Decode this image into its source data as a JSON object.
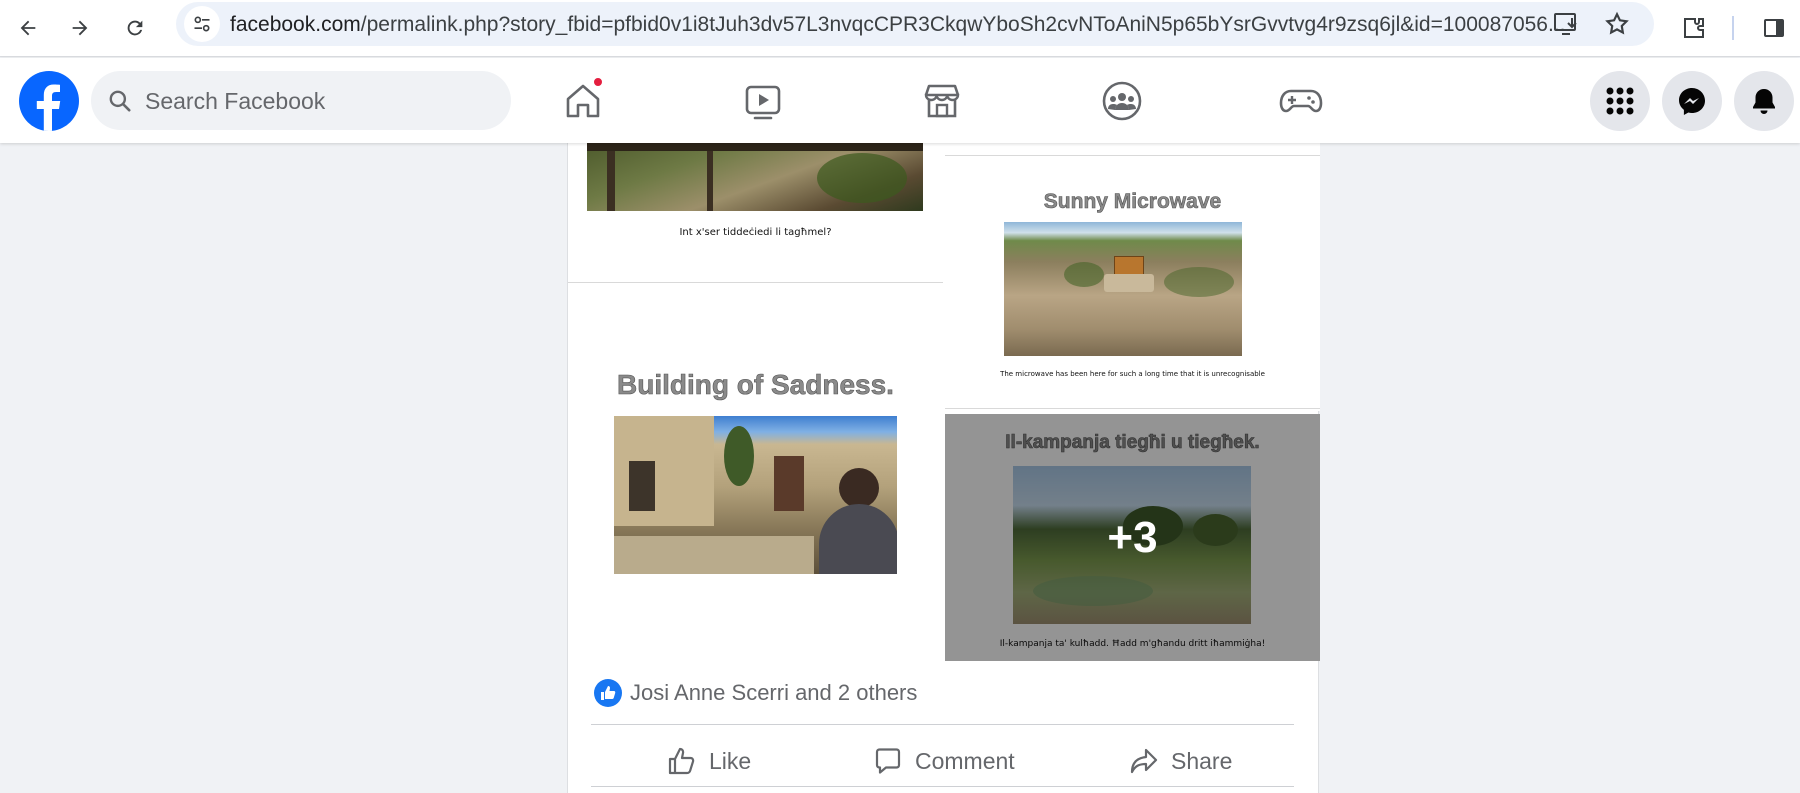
{
  "browser": {
    "url_host": "facebook.com",
    "url_rest": "/permalink.php?story_fbid=pfbid0v1i8tJuh3dv57L3nvqcCPR3CkqwYboSh2cvNToAniN5p65bYsrGvvtvg4r9zsq6jl&id=100087056..."
  },
  "header": {
    "search_placeholder": "Search Facebook"
  },
  "post": {
    "tile1": {
      "caption": "Int x'ser tiddeċiedi li tagħmel?"
    },
    "tile2": {
      "title": "Sunny Microwave",
      "caption": "The microwave has been here for such a long time that it is unrecognisable"
    },
    "tile3": {
      "title": "Building of Sadness."
    },
    "tile4": {
      "title": "Il-kampanja tiegħi u tiegħek.",
      "caption": "Il-kampanja ta' kulħadd. Ħadd m'għandu dritt iħammiġha!",
      "more_count": "+3"
    },
    "reactions_text": "Josi Anne Scerri and 2 others",
    "actions": {
      "like": "Like",
      "comment": "Comment",
      "share": "Share"
    }
  },
  "colors": {
    "facebook_blue": "#0866ff",
    "notification_red": "#e41e3f"
  }
}
